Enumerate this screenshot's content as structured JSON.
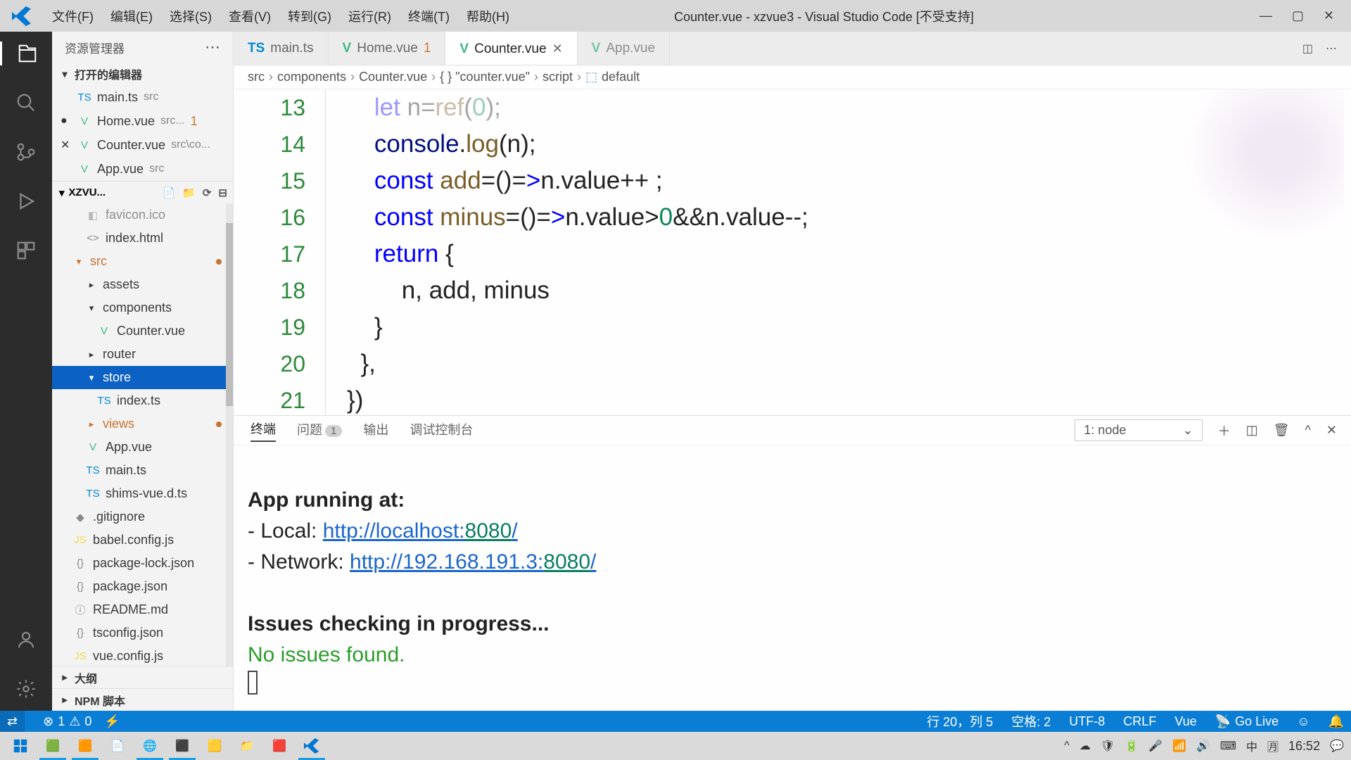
{
  "menubar": {
    "items": [
      "文件(F)",
      "编辑(E)",
      "选择(S)",
      "查看(V)",
      "转到(G)",
      "运行(R)",
      "终端(T)",
      "帮助(H)"
    ],
    "title": "Counter.vue - xzvue3 - Visual Studio Code [不受支持]"
  },
  "sidebar": {
    "header": "资源管理器",
    "openEditors": {
      "title": "打开的编辑器",
      "items": [
        {
          "icon": "TS",
          "name": "main.ts",
          "sub": "src"
        },
        {
          "icon": "V",
          "name": "Home.vue",
          "sub": "src...",
          "badge": "1",
          "dirty": true
        },
        {
          "icon": "V",
          "name": "Counter.vue",
          "sub": "src\\co...",
          "close": true
        },
        {
          "icon": "V",
          "name": "App.vue",
          "sub": "src"
        }
      ]
    },
    "folder": {
      "name": "XZVU...",
      "tree": [
        {
          "lvl": 2,
          "icon": "◧",
          "name": "favicon.ico",
          "fade": true
        },
        {
          "lvl": 2,
          "icon": "<>",
          "name": "index.html"
        },
        {
          "lvl": 1,
          "chev": "▾",
          "name": "src",
          "orange": true,
          "dot": true
        },
        {
          "lvl": 2,
          "chev": "▸",
          "name": "assets"
        },
        {
          "lvl": 2,
          "chev": "▾",
          "name": "components"
        },
        {
          "lvl": 3,
          "icon": "V",
          "name": "Counter.vue"
        },
        {
          "lvl": 2,
          "chev": "▸",
          "name": "router"
        },
        {
          "lvl": 2,
          "chev": "▾",
          "name": "store",
          "selected": true
        },
        {
          "lvl": 3,
          "icon": "TS",
          "name": "index.ts"
        },
        {
          "lvl": 2,
          "chev": "▸",
          "name": "views",
          "orange": true,
          "dot": true
        },
        {
          "lvl": 2,
          "icon": "V",
          "name": "App.vue"
        },
        {
          "lvl": 2,
          "icon": "TS",
          "name": "main.ts"
        },
        {
          "lvl": 2,
          "icon": "TS",
          "name": "shims-vue.d.ts"
        },
        {
          "lvl": 1,
          "icon": "◆",
          "name": ".gitignore"
        },
        {
          "lvl": 1,
          "icon": "JS",
          "name": "babel.config.js"
        },
        {
          "lvl": 1,
          "icon": "{}",
          "name": "package-lock.json"
        },
        {
          "lvl": 1,
          "icon": "{}",
          "name": "package.json"
        },
        {
          "lvl": 1,
          "icon": "ⓘ",
          "name": "README.md"
        },
        {
          "lvl": 1,
          "icon": "{}",
          "name": "tsconfig.json"
        },
        {
          "lvl": 1,
          "icon": "JS",
          "name": "vue.config.js"
        }
      ]
    },
    "outline": "大纲",
    "npm": "NPM 脚本"
  },
  "tabs": [
    {
      "icon": "TS",
      "label": "main.ts"
    },
    {
      "icon": "V",
      "label": "Home.vue",
      "badge": "1"
    },
    {
      "icon": "V",
      "label": "Counter.vue",
      "active": true,
      "closable": true
    },
    {
      "icon": "V",
      "label": "App.vue",
      "fade": true
    }
  ],
  "breadcrumb": [
    "src",
    "components",
    "Counter.vue",
    "{ } \"counter.vue\"",
    "script",
    "default"
  ],
  "code": {
    "lines": [
      {
        "n": "13",
        "html": "<span class='kw'>let</span> n=<span class='fn'>ref</span>(<span class='nm'>0</span>);",
        "fade": true
      },
      {
        "n": "14",
        "html": "<span class='pr'>console</span>.<span class='fn'>log</span>(n);"
      },
      {
        "n": "15",
        "html": "<span class='kw'>const</span> <span class='fn'>add</span>=()=<span class='kw'>></span>n.value++ ;"
      },
      {
        "n": "16",
        "html": "<span class='kw'>const</span> <span class='fn'>minus</span>=()=<span class='kw'>></span>n.value><span class='nm'>0</span>&amp;&amp;n.value--;"
      },
      {
        "n": "17",
        "html": "<span class='kw'>return</span> {"
      },
      {
        "n": "18",
        "html": "  n, add, minus"
      },
      {
        "n": "19",
        "html": "}"
      },
      {
        "n": "20",
        "html": "},",
        "hl": true
      },
      {
        "n": "21",
        "html": "})",
        "mark": true
      }
    ]
  },
  "panel": {
    "tabs": [
      {
        "label": "终端",
        "active": true
      },
      {
        "label": "问题",
        "badge": "1"
      },
      {
        "label": "输出"
      },
      {
        "label": "调试控制台"
      }
    ],
    "select": "1: node",
    "terminal": {
      "lines": [
        {
          "html": "<span class='bold'>App running at:</span>"
        },
        {
          "html": "- Local:   <span class='url'>http://localhost:</span><span class='port'>8080</span><span class='url'>/</span>"
        },
        {
          "html": "- Network: <span class='url'>http://192.168.191.3:</span><span class='port'>8080</span><span class='url'>/</span>"
        },
        {
          "html": ""
        },
        {
          "html": "<span class='bold'>Issues checking in progress...</span>"
        },
        {
          "html": "<span class='green'>No issues found.</span>"
        }
      ]
    }
  },
  "statusbar": {
    "errors": "1",
    "warnings": "0",
    "right": [
      "行 20，列 5",
      "空格: 2",
      "UTF-8",
      "CRLF",
      "Vue",
      "Go Live"
    ]
  },
  "taskbar": {
    "clock": "16:52"
  }
}
